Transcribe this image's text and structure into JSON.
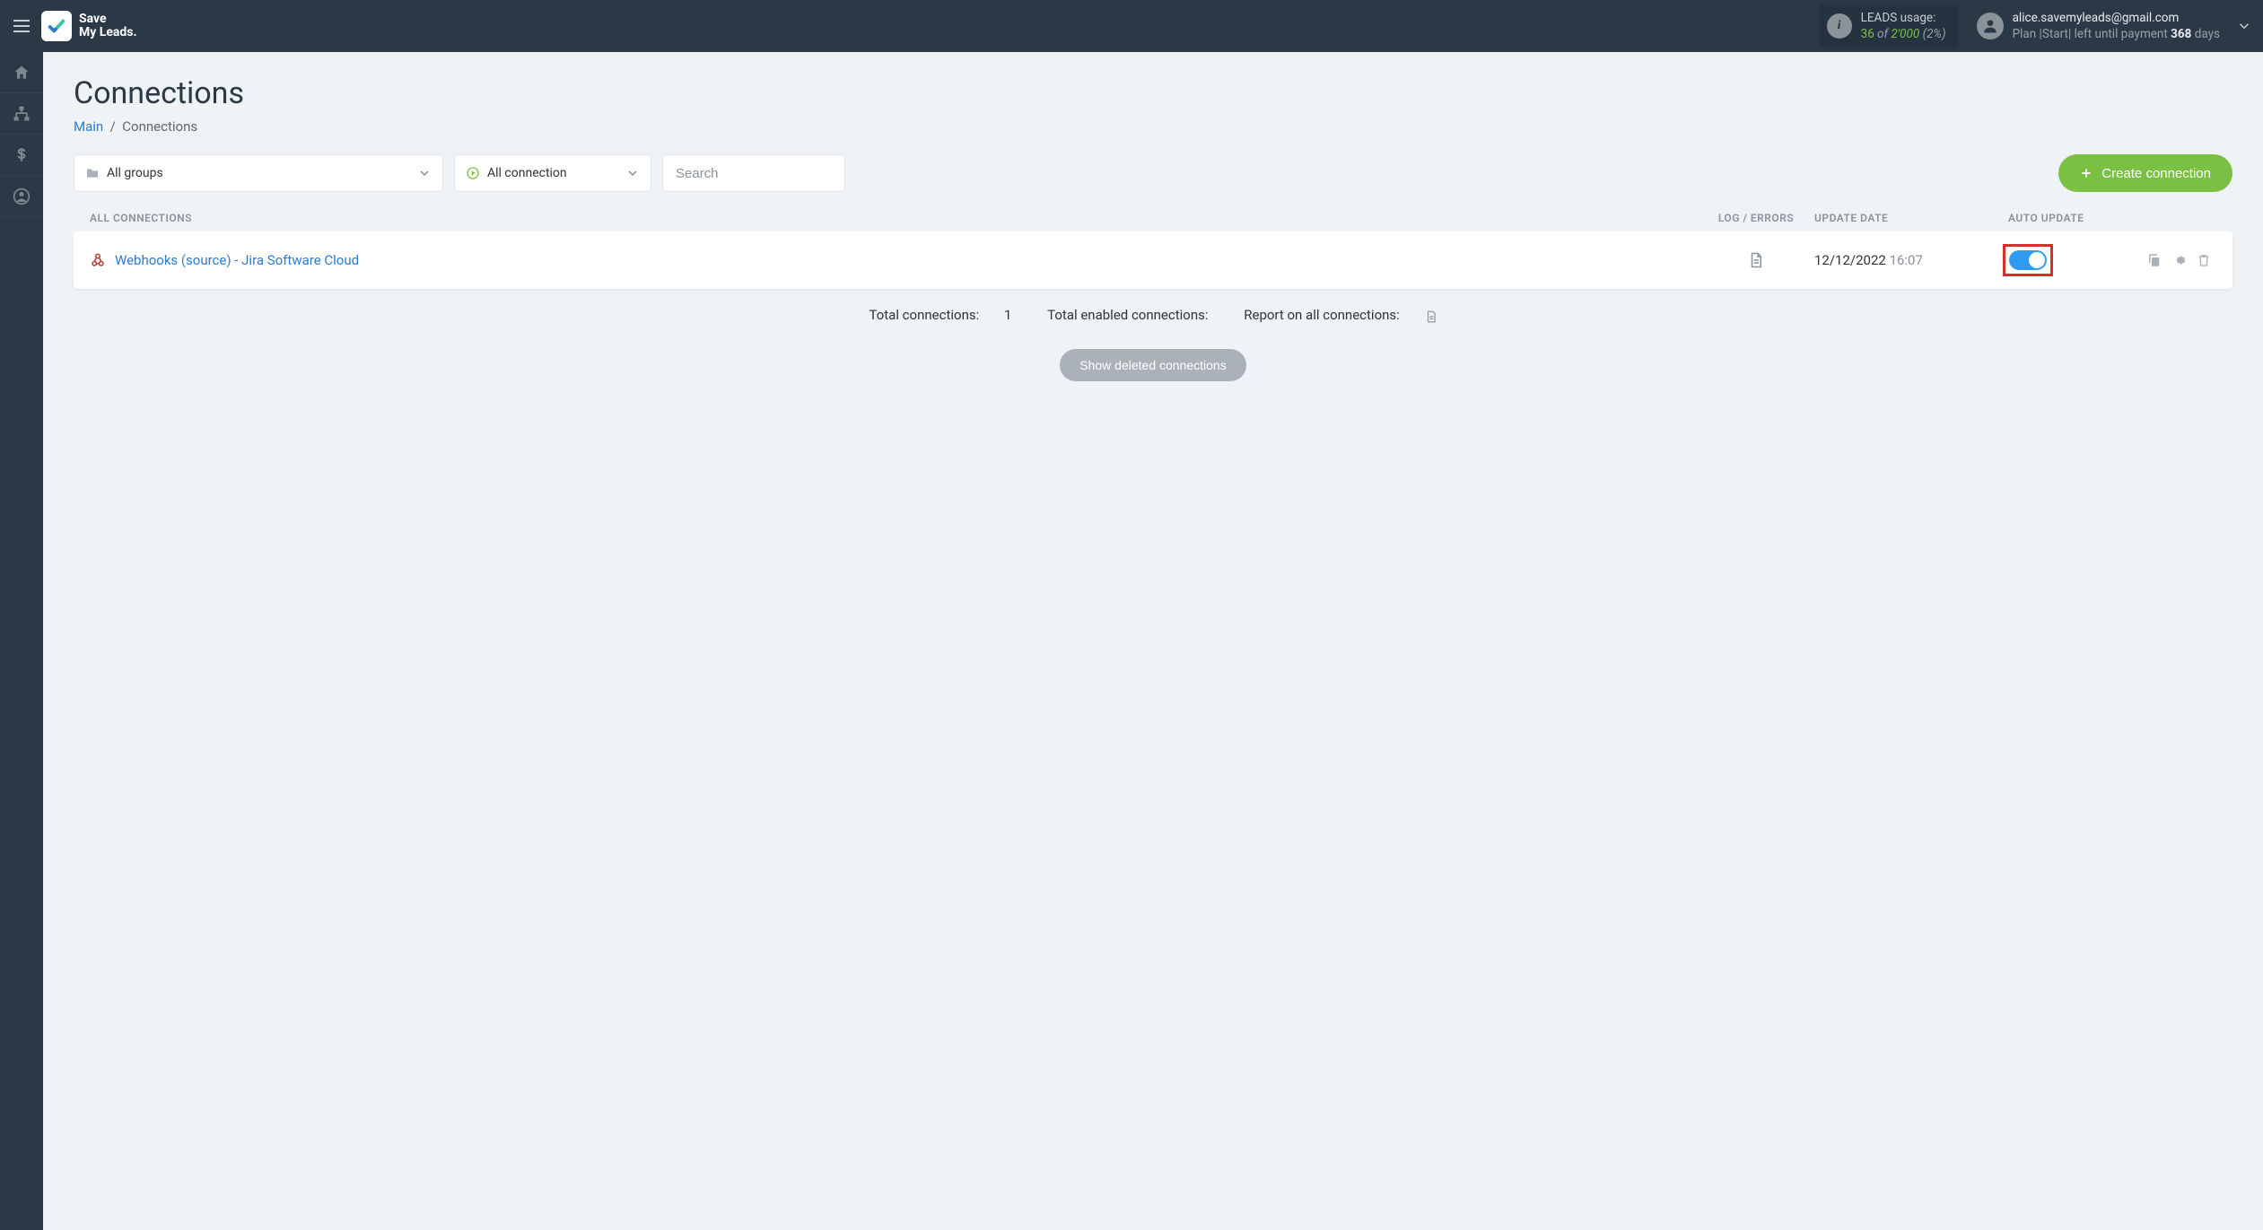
{
  "brand": {
    "line1": "Save",
    "line2": "My Leads."
  },
  "usage": {
    "label": "LEADS usage:",
    "current": "36",
    "of_text": "of",
    "total": "2'000",
    "percent": "(2%)"
  },
  "account": {
    "email": "alice.savemyleads@gmail.com",
    "plan_prefix": "Plan |",
    "plan_name": "Start",
    "plan_suffix": "| left until payment",
    "days_num": "368",
    "days_word": "days"
  },
  "page": {
    "title": "Connections",
    "breadcrumb_main": "Main",
    "breadcrumb_current": "Connections"
  },
  "filters": {
    "groups": "All groups",
    "connection": "All connection",
    "search_placeholder": "Search"
  },
  "buttons": {
    "create": "Create connection",
    "show_deleted": "Show deleted connections"
  },
  "table": {
    "headers": {
      "name": "ALL CONNECTIONS",
      "log": "LOG / ERRORS",
      "date": "UPDATE DATE",
      "auto": "AUTO UPDATE"
    },
    "row": {
      "name": "Webhooks (source) - Jira Software Cloud",
      "date": "12/12/2022",
      "time": "16:07"
    }
  },
  "summary": {
    "total_label": "Total connections:",
    "total_value": "1",
    "enabled_label": "Total enabled connections:",
    "report_label": "Report on all connections:"
  }
}
